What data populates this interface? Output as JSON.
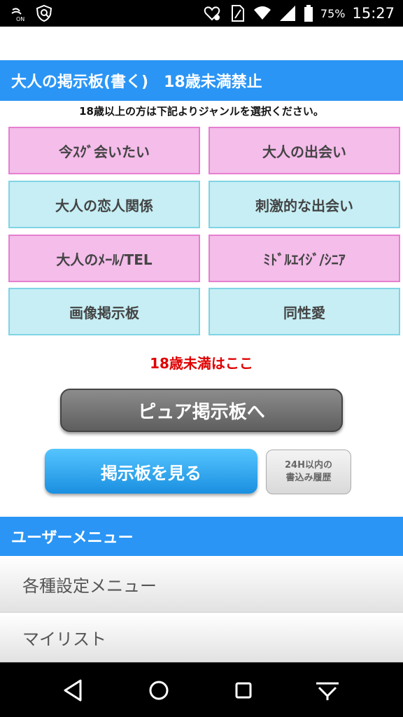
{
  "status_bar": {
    "battery_percent": "75%",
    "time": "15:27",
    "icons": [
      "nfc-on-icon",
      "shield-icon",
      "heart-alert-icon",
      "sim-icon",
      "wifi-icon",
      "signal-icon",
      "battery-icon"
    ],
    "nfc_label": "ON"
  },
  "header": {
    "title": "大人の掲示板(書く)　18歳未満禁止"
  },
  "intro": "18歳以上の方は下記よりジャンルを選択ください。",
  "genres": [
    {
      "label": "今ｽｸﾞ会いたい",
      "color": "pink"
    },
    {
      "label": "大人の出会い",
      "color": "pink"
    },
    {
      "label": "大人の恋人関係",
      "color": "cyan"
    },
    {
      "label": "刺激的な出会い",
      "color": "cyan"
    },
    {
      "label": "大人のﾒｰﾙ/TEL",
      "color": "pink"
    },
    {
      "label": "ﾐﾄﾞﾙｴｲｼﾞ/ｼﾆｱ",
      "color": "pink"
    },
    {
      "label": "画像掲示板",
      "color": "cyan"
    },
    {
      "label": "同性愛",
      "color": "cyan"
    }
  ],
  "under18_link": "18歳未満はここ",
  "pure_button": "ピュア掲示板へ",
  "view_button": "掲示板を見る",
  "history_button": {
    "line1": "24H以内の",
    "line2": "書込み履歴"
  },
  "user_menu": {
    "title": "ユーザーメニュー",
    "items": [
      "各種設定メニュー",
      "マイリスト"
    ]
  },
  "colors": {
    "accent_blue": "#2a95f5",
    "genre_pink": "#f4bdea",
    "genre_cyan": "#c6eef4",
    "warning_red": "#e00000"
  }
}
